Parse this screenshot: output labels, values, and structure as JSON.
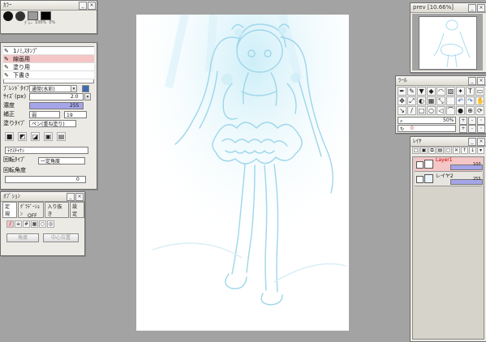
{
  "color_panel": {
    "title": "ｶﾗｰ",
    "labels": [
      "ｸﾞﾚｰ",
      "100%",
      "0%",
      "100"
    ]
  },
  "brush_panel": {
    "items": [
      "1ﾉﾐ,ｽﾀﾝﾌﾟ",
      "線画用",
      "塗り用",
      "下書き"
    ],
    "blend_label": "ﾌﾞﾚﾝﾄﾞﾀｲﾌﾟ",
    "blend_value": "通常(水彩)",
    "size_label": "ｻｲｽﾞ(px)",
    "size_value": "2.0",
    "density_label": "濃度",
    "density_value": "255",
    "correction_label": "補正",
    "correction_value": "弱",
    "correction_value2": "19",
    "paint_type_label": "塗りﾀｲﾌﾟ",
    "paint_type_value": "ペン(重ね塗り)",
    "texture_value": "ﾃｸｽﾁｬﾅｼ",
    "rotate_type_label": "回転ﾀｲﾌﾟ",
    "rotate_type_value": "一定角度",
    "rotate_angle_label": "回転角度",
    "rotate_angle_value": "0"
  },
  "option_panel": {
    "title": "ｵﾌﾟｼｮﾝ",
    "tabs": [
      "定規",
      "ｸﾞﾗﾃﾞｰｼｮﾝ",
      "入り抜き",
      "設定"
    ],
    "off_label": "OFF",
    "buttons": [
      "角度",
      "中心位置"
    ]
  },
  "preview_panel": {
    "title": "prev [10.66%]"
  },
  "tool_panel": {
    "title": "ﾂｰﾙ",
    "zoom_value": "50%",
    "rotate_value": "0"
  },
  "layer_panel": {
    "title": "ﾚｲﾔ",
    "layers": [
      {
        "name": "Layer1",
        "opacity": "100"
      },
      {
        "name": "レイヤ2",
        "opacity": "255"
      }
    ]
  },
  "colors": {
    "canvas_bg": "#ffffff",
    "workspace": "#a3a3a3",
    "highlight": "#f4c6c6",
    "slider": "#a4a4e8"
  }
}
